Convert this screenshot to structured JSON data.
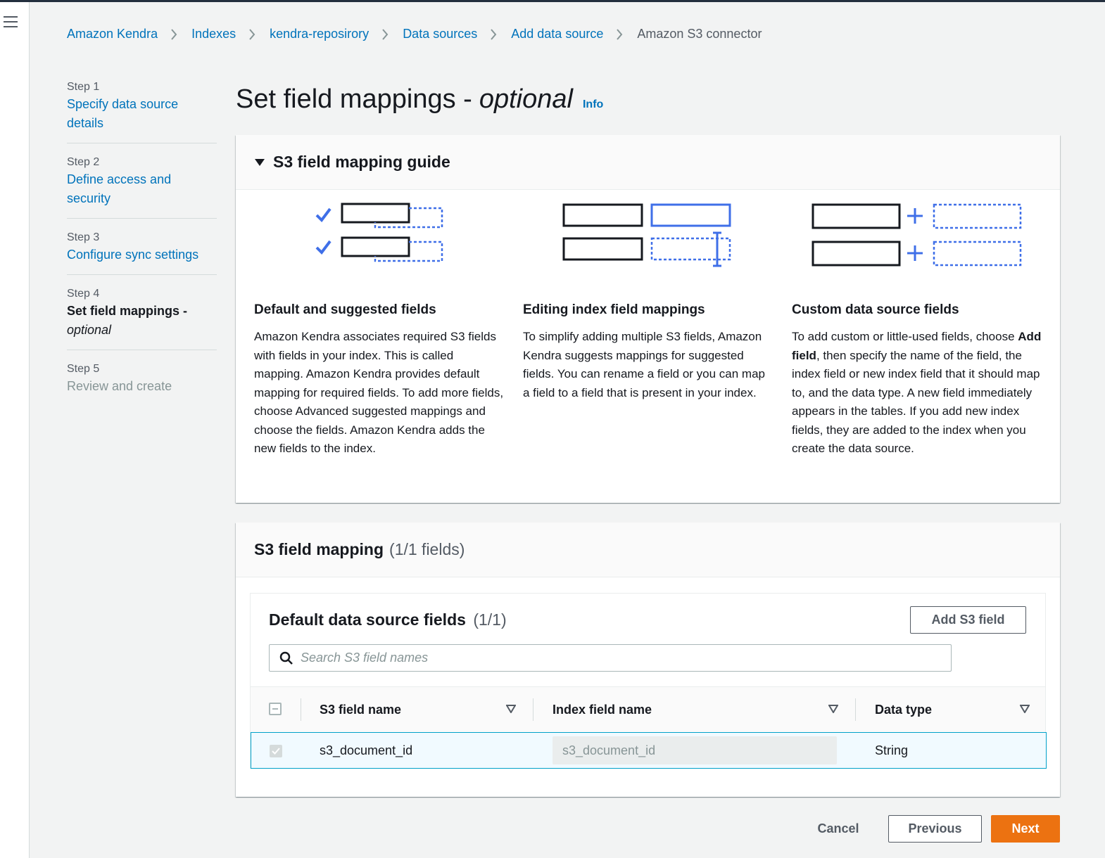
{
  "breadcrumb": {
    "items": [
      "Amazon Kendra",
      "Indexes",
      "kendra-reposirory",
      "Data sources",
      "Add data source"
    ],
    "current": "Amazon S3 connector"
  },
  "steps": [
    {
      "num": "Step 1",
      "title": "Specify data source details"
    },
    {
      "num": "Step 2",
      "title": "Define access and security"
    },
    {
      "num": "Step 3",
      "title": "Configure sync settings"
    },
    {
      "num": "Step 4",
      "title_main": "Set field mappings -",
      "title_italic": "optional",
      "state": "active"
    },
    {
      "num": "Step 5",
      "title": "Review and create",
      "state": "disabled"
    }
  ],
  "page": {
    "title": "Set field mappings -",
    "title_italic": "optional",
    "info": "Info"
  },
  "guide": {
    "title": "S3 field mapping guide",
    "columns": [
      {
        "heading": "Default and suggested fields",
        "body": "Amazon Kendra associates required S3 fields with fields in your index. This is called mapping. Amazon Kendra provides default mapping for required fields. To add more fields, choose Advanced suggested mappings and choose the fields. Amazon Kendra adds the new fields to the index."
      },
      {
        "heading": "Editing index field mappings",
        "body": "To simplify adding multiple S3 fields, Amazon Kendra suggests mappings for suggested fields. You can rename a field or you can map a field to a field that is present in your index."
      },
      {
        "heading": "Custom data source fields",
        "body_pre": "To add custom or little-used fields, choose ",
        "body_bold": "Add field",
        "body_post": ", then specify the name of the field, the index field or new index field that it should map to, and the data type. A new field immediately appears in the tables. If you add new index fields, they are added to the index when you create the data source."
      }
    ]
  },
  "mapping": {
    "title": "S3 field mapping",
    "count": "(1/1 fields)",
    "table_title": "Default data source fields",
    "table_count": "(1/1)",
    "add_button": "Add S3 field",
    "search_placeholder": "Search S3 field names",
    "columns": [
      "S3 field name",
      "Index field name",
      "Data type"
    ],
    "rows": [
      {
        "s3_field": "s3_document_id",
        "index_field": "s3_document_id",
        "data_type": "String"
      }
    ]
  },
  "footer": {
    "cancel": "Cancel",
    "previous": "Previous",
    "next": "Next"
  },
  "colors": {
    "link": "#0073bb",
    "primary_button": "#ec7211",
    "illustration_blue": "#3f6fe8",
    "illustration_dark": "#16191f"
  }
}
